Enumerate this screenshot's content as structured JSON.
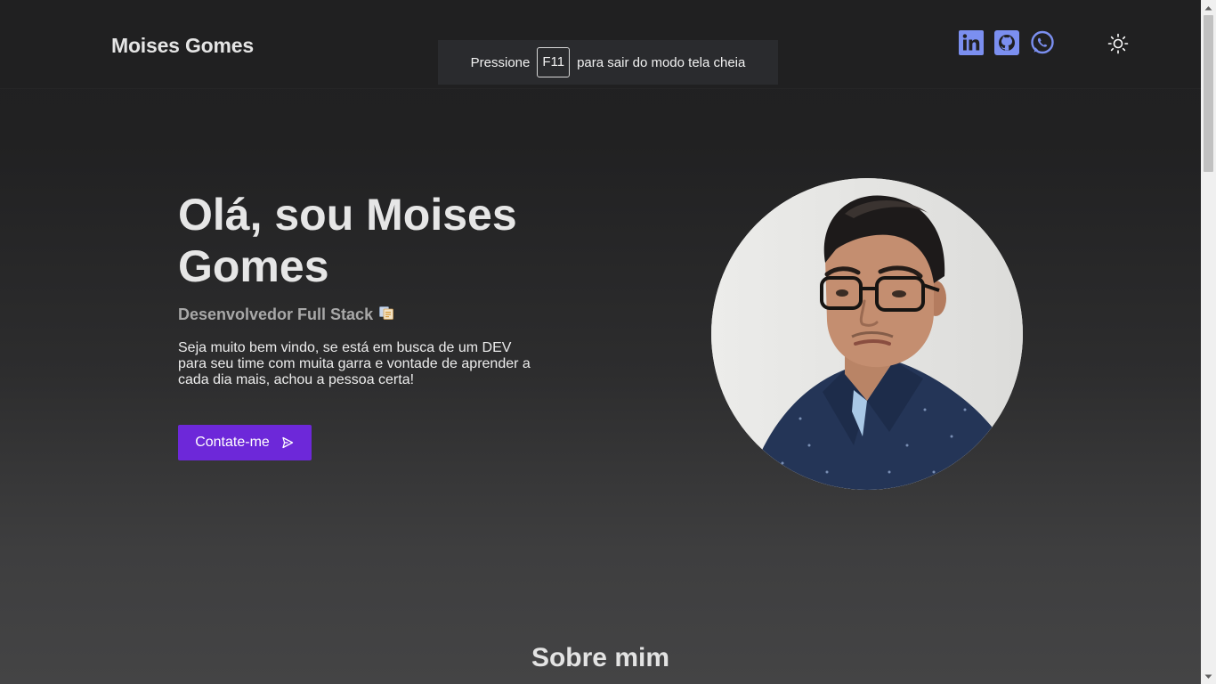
{
  "header": {
    "brand": "Moises Gomes",
    "socials": [
      {
        "name": "linkedin-icon"
      },
      {
        "name": "github-icon"
      },
      {
        "name": "whatsapp-icon"
      }
    ],
    "theme_icon": "sun-icon"
  },
  "fullscreen_notice": {
    "before": "Pressione",
    "key": "F11",
    "after": "para sair do modo tela cheia"
  },
  "hero": {
    "title": "Olá, sou Moises Gomes",
    "subtitle": "Desenvolvedor Full Stack",
    "subtitle_icon": "clipboard-emoji-icon",
    "description": "Seja muito bem vindo, se está em busca de um DEV para seu time com muita garra e vontade de aprender a cada dia mais, achou a pessoa certa!",
    "cta_label": "Contate-me",
    "cta_icon": "send-icon"
  },
  "about": {
    "title": "Sobre mim"
  },
  "colors": {
    "accent": "#6d28d9",
    "social_icon": "#7b8ff0",
    "background_top": "#202021",
    "background_bottom": "#444445"
  }
}
